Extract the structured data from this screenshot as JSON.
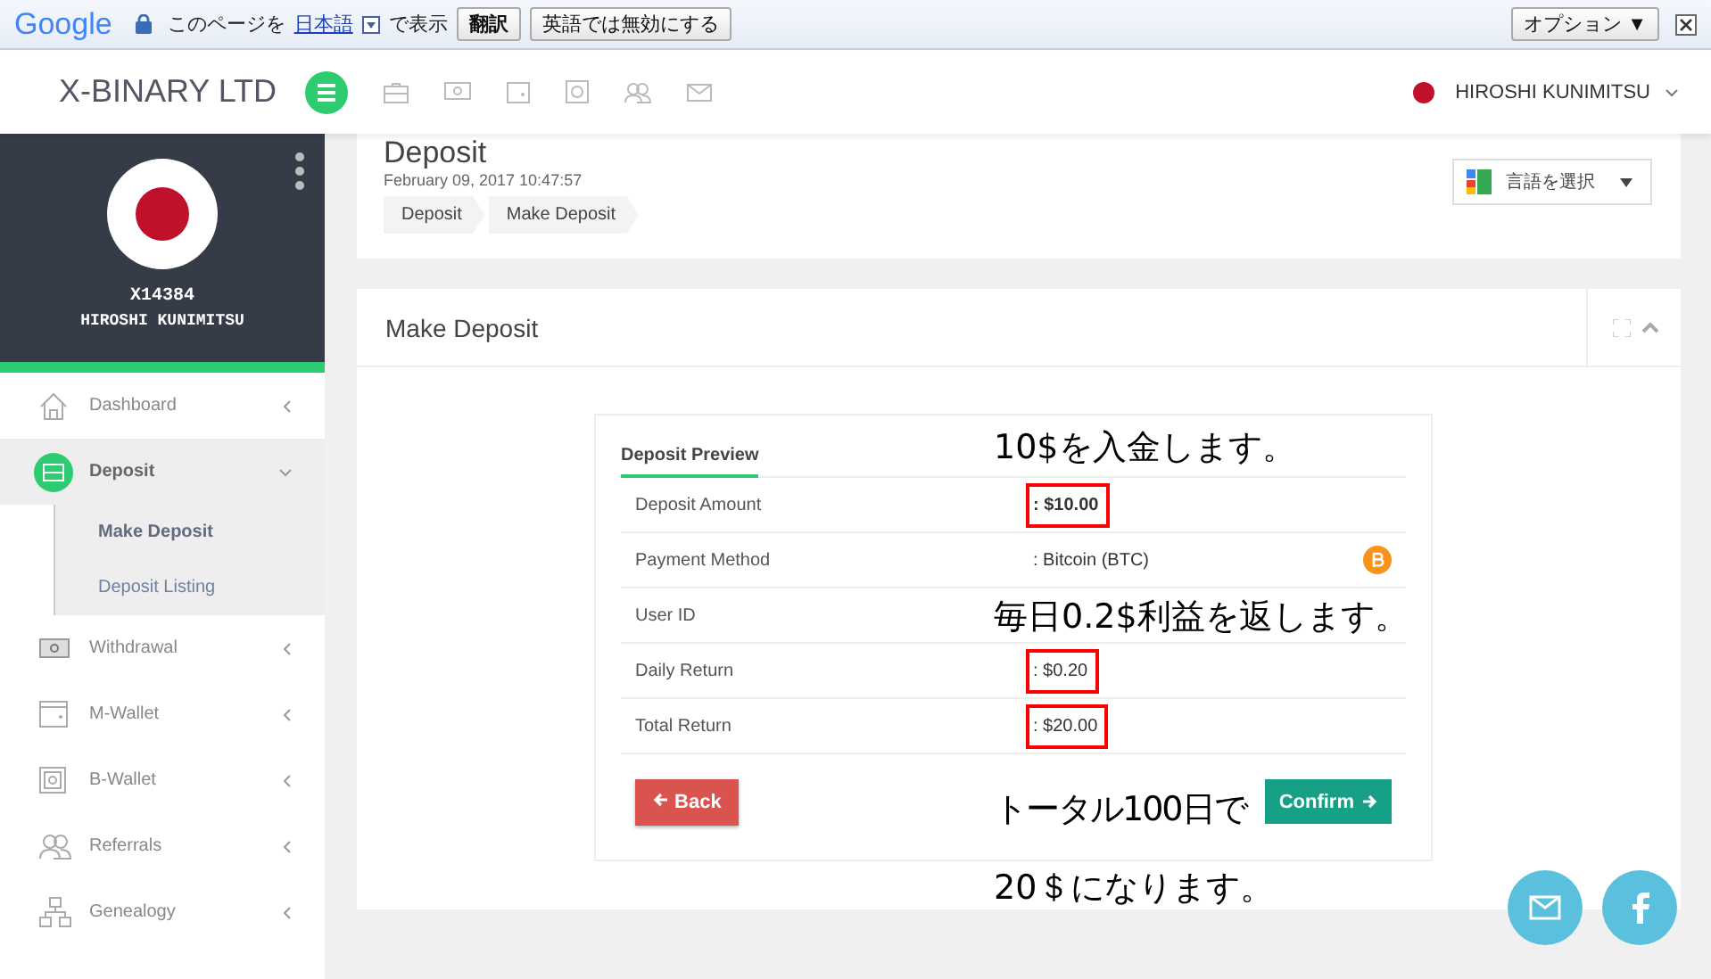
{
  "translate_bar": {
    "logo": "Google",
    "prefix": "このページを",
    "language": "日本語",
    "suffix": "で表示",
    "translate_button": "翻訳",
    "disable_button": "英語では無効にする",
    "options_button": "オプション ▼"
  },
  "header": {
    "brand": "X-BINARY LTD",
    "user": "HIROSHI KUNIMITSU"
  },
  "profile": {
    "user_id": "X14384",
    "name": "HIROSHI KUNIMITSU"
  },
  "sidebar": {
    "items": [
      {
        "kind": "home",
        "label": "Dashboard",
        "selected": false,
        "expanded": false
      },
      {
        "kind": "briefcase",
        "label": "Deposit",
        "selected": true,
        "expanded": true,
        "children": [
          {
            "label": "Make Deposit",
            "selected": true
          },
          {
            "label": "Deposit Listing",
            "selected": false
          }
        ]
      },
      {
        "kind": "cash",
        "label": "Withdrawal",
        "selected": false,
        "expanded": false
      },
      {
        "kind": "wallet",
        "label": "M-Wallet",
        "selected": false,
        "expanded": false
      },
      {
        "kind": "safe",
        "label": "B-Wallet",
        "selected": false,
        "expanded": false
      },
      {
        "kind": "users",
        "label": "Referrals",
        "selected": false,
        "expanded": false
      },
      {
        "kind": "tree",
        "label": "Genealogy",
        "selected": false,
        "expanded": false
      }
    ]
  },
  "page_header": {
    "title": "Deposit",
    "date": "February 09, 2017 10:47:57",
    "breadcrumbs": [
      "Deposit",
      "Make Deposit"
    ],
    "language_select": "言語を選択"
  },
  "panel": {
    "title": "Make Deposit",
    "preview_title": "Deposit Preview",
    "rows": [
      {
        "kind": "text",
        "label": "Deposit Amount",
        "value": ": $10.00",
        "bold": true,
        "highlighted": true
      },
      {
        "kind": "bitcoin",
        "label": "Payment Method",
        "value": ": Bitcoin (BTC)",
        "bold": false,
        "highlighted": false
      },
      {
        "kind": "text",
        "label": "User ID"
      },
      {
        "kind": "text",
        "label": "Daily Return",
        "value": ": $0.20",
        "bold": false,
        "highlighted": true
      },
      {
        "kind": "text",
        "label": "Total Return",
        "value": ": $20.00",
        "bold": false,
        "highlighted": true
      }
    ],
    "back_button": "Back",
    "confirm_button": "Confirm"
  },
  "annotations": [
    "10$を入金します。",
    "毎日0.2$利益を返します。",
    "トータル100日で",
    "20＄になります。"
  ]
}
